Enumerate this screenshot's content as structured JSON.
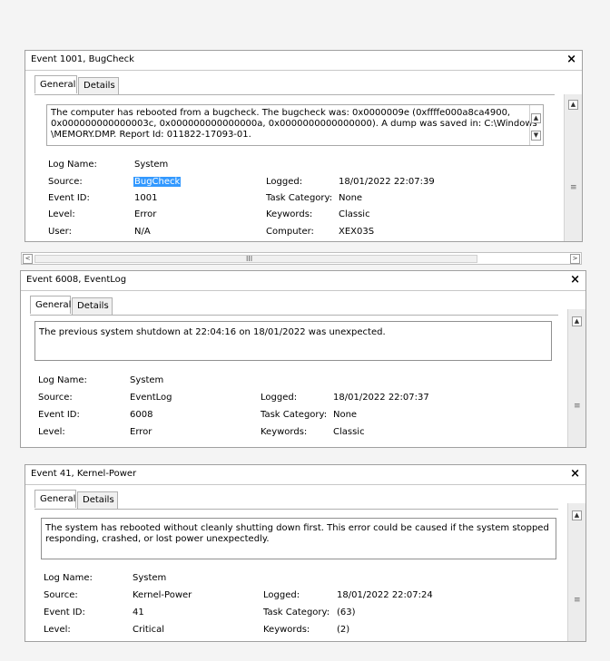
{
  "panels": [
    {
      "title": "Event 1001, BugCheck",
      "tabs": [
        "General",
        "Details"
      ],
      "description": [
        "The computer has rebooted from a bugcheck.  The bugcheck was: 0x0000009e (0xffffe000a8ca4900,",
        "0x000000000000003c, 0x000000000000000a, 0x0000000000000000). A dump was saved in: C:\\Windows",
        "\\MEMORY.DMP. Report Id: 011822-17093-01."
      ],
      "fields": {
        "log_name_label": "Log Name:",
        "log_name": "System",
        "source_label": "Source:",
        "source": "BugCheck",
        "logged_label": "Logged:",
        "logged": "18/01/2022 22:07:39",
        "event_id_label": "Event ID:",
        "event_id": "1001",
        "task_category_label": "Task Category:",
        "task_category": "None",
        "level_label": "Level:",
        "level": "Error",
        "keywords_label": "Keywords:",
        "keywords": "Classic",
        "user_label": "User:",
        "user": "N/A",
        "computer_label": "Computer:",
        "computer": "XEX03S"
      }
    },
    {
      "title": "Event 6008, EventLog",
      "tabs": [
        "General",
        "Details"
      ],
      "description": [
        "The previous system shutdown at 22:04:16 on 18/01/2022 was unexpected."
      ],
      "fields": {
        "log_name_label": "Log Name:",
        "log_name": "System",
        "source_label": "Source:",
        "source": "EventLog",
        "logged_label": "Logged:",
        "logged": "18/01/2022 22:07:37",
        "event_id_label": "Event ID:",
        "event_id": "6008",
        "task_category_label": "Task Category:",
        "task_category": "None",
        "level_label": "Level:",
        "level": "Error",
        "keywords_label": "Keywords:",
        "keywords": "Classic"
      }
    },
    {
      "title": "Event 41, Kernel-Power",
      "tabs": [
        "General",
        "Details"
      ],
      "description": [
        "The system has rebooted without cleanly shutting down first. This error could be caused if the system stopped",
        "responding, crashed, or lost power unexpectedly."
      ],
      "fields": {
        "log_name_label": "Log Name:",
        "log_name": "System",
        "source_label": "Source:",
        "source": "Kernel-Power",
        "logged_label": "Logged:",
        "logged": "18/01/2022 22:07:24",
        "event_id_label": "Event ID:",
        "event_id": "41",
        "task_category_label": "Task Category:",
        "task_category": "(63)",
        "level_label": "Level:",
        "level": "Critical",
        "keywords_label": "Keywords:",
        "keywords": "(2)"
      }
    }
  ],
  "glyphs": {
    "close": "×",
    "up": "▲",
    "down": "▼",
    "left": "<",
    "right": ">",
    "grip": "≡",
    "hgrip": "III"
  }
}
